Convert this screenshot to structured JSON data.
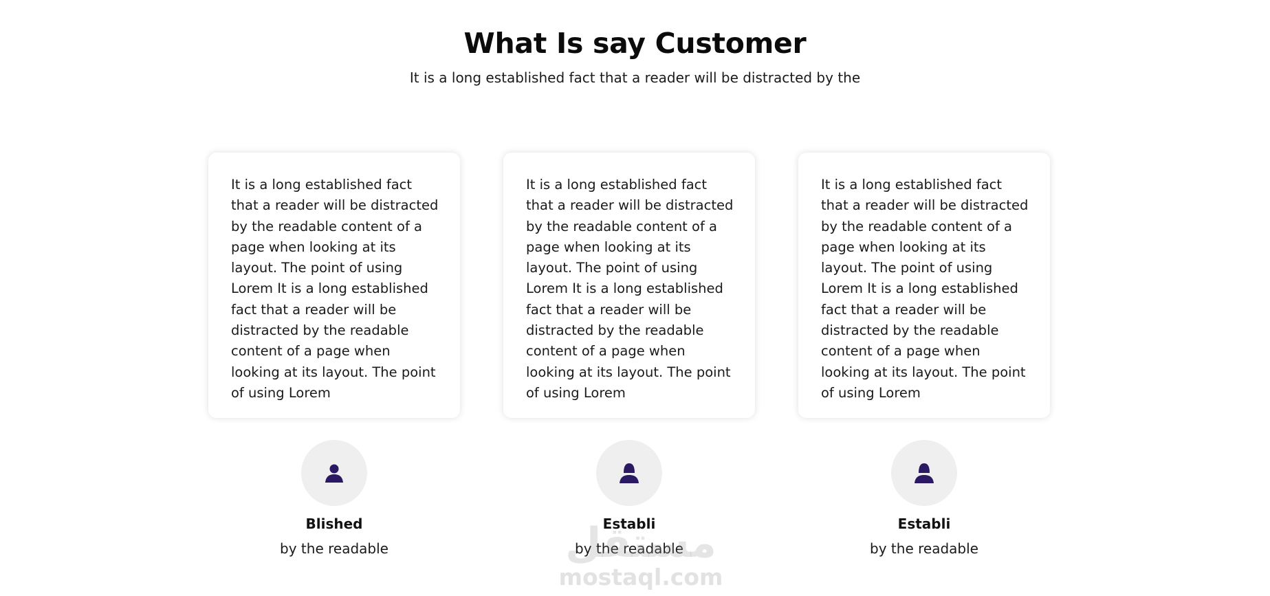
{
  "section": {
    "title": "What Is say Customer",
    "subtitle": "It is a long established fact that a reader will be distracted by the"
  },
  "testimonials": [
    {
      "text": "It is a long established fact that a reader will be distracted by the readable content of a page when looking at its layout. The point of using Lorem It is a long established fact that a reader will be distracted by the readable content of a page when looking at its layout. The point of using Lorem",
      "avatar_icon": "male-user-icon",
      "name": "Blished",
      "role": "by the readable"
    },
    {
      "text": "It is a long established fact that a reader will be distracted by the readable content of a page when looking at its layout. The point of using Lorem It is a long established fact that a reader will be distracted by the readable content of a page when looking at its layout. The point of using Lorem",
      "avatar_icon": "female-user-icon",
      "name": "Establi",
      "role": "by the readable"
    },
    {
      "text": "It is a long established fact that a reader will be distracted by the readable content of a page when looking at its layout. The point of using Lorem It is a long established fact that a reader will be distracted by the readable content of a page when looking at its layout. The point of using Lorem",
      "avatar_icon": "female-user-icon",
      "name": "Establi",
      "role": "by the readable"
    }
  ],
  "watermark": {
    "arabic": "مستقل",
    "latin": "mostaql.com"
  },
  "colors": {
    "avatar_icon": "#2b1a63",
    "avatar_bg": "#efefef",
    "card_bg": "#ffffff"
  }
}
